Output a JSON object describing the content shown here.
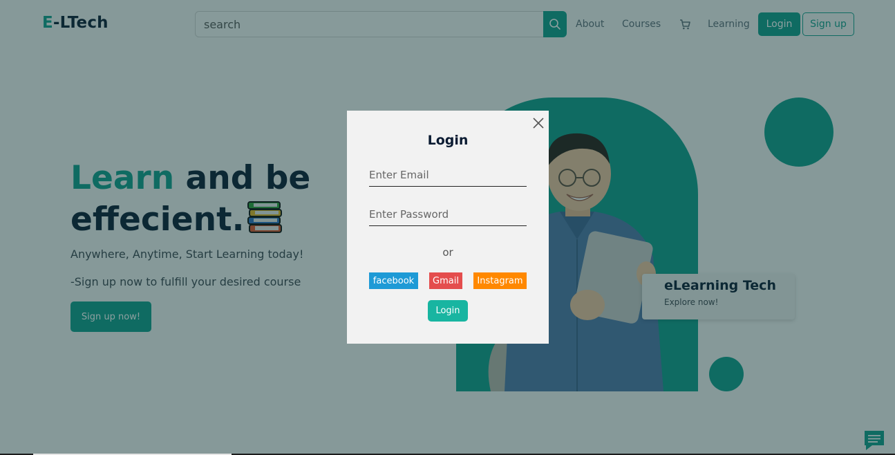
{
  "nav": {
    "logo_accent": "E",
    "logo_rest": "-LTech",
    "search_placeholder": "search",
    "about": "About",
    "courses": "Courses",
    "learning": "Learning",
    "login": "Login",
    "signup": "Sign up",
    "cart_icon": "cart-icon",
    "search_icon": "search-icon"
  },
  "hero": {
    "title_accent": "Learn",
    "title_rest1": " and be",
    "title_line2": "effecient.",
    "subtitle": "Anywhere, Anytime, Start Learning today!",
    "subtitle2": "-Sign up now to fulfill your desired course",
    "cta": "Sign up now!",
    "icon": "books-icon"
  },
  "card": {
    "title": "eLearning Tech",
    "subtitle": "Explore now!"
  },
  "modal": {
    "title": "Login",
    "email_placeholder": "Enter Email",
    "password_placeholder": "Enter Password",
    "or": "or",
    "facebook": "facebook",
    "gmail": "Gmail",
    "instagram": "Instagram",
    "login": "Login"
  },
  "colors": {
    "accent": "#119c8b",
    "dark": "#0b1b32",
    "facebook": "#1e9ad6",
    "gmail": "#e44d4d",
    "instagram": "#ff8800"
  }
}
